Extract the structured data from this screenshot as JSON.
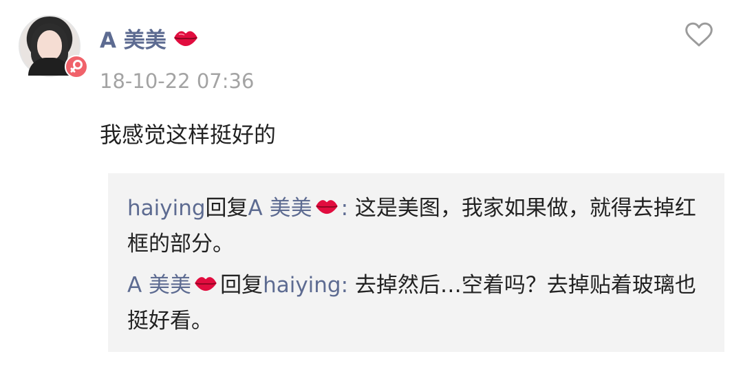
{
  "comment": {
    "author": "A 美美",
    "timestamp": "18-10-22 07:36",
    "text": "我感觉这样挺好的"
  },
  "replies": [
    {
      "from": "haiying",
      "reply_word": "回复",
      "to": "A 美美",
      "text": "这是美图，我家如果做，就得去掉红框的部分。"
    },
    {
      "from": "A 美美",
      "reply_word": "回复",
      "to": "haiying",
      "text": "去掉然后…空着吗？去掉贴着玻璃也挺好看。"
    }
  ],
  "colors": {
    "username": "#5d6b91",
    "timestamp": "#a3a3a3",
    "text": "#222222",
    "reply_background": "#f3f3f3",
    "gender_badge": "#f0626a"
  },
  "icons": {
    "lips": "kiss-mark-icon",
    "like": "heart-outline-icon",
    "gender": "female-icon"
  }
}
